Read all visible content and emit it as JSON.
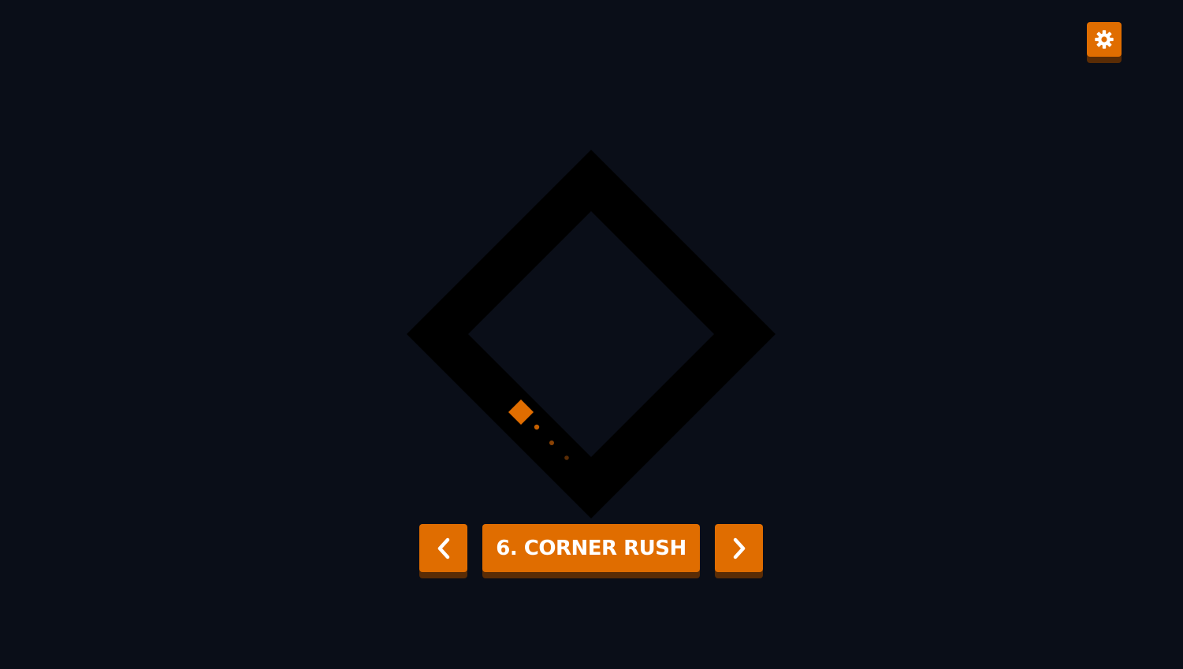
{
  "game": {
    "level_label": "6. CORNER RUSH"
  },
  "icons": {
    "settings": "gear-icon",
    "previous": "chevron-left-icon",
    "next": "chevron-right-icon"
  },
  "colors": {
    "background": "#0a0e18",
    "track": "#000000",
    "accent": "#e06d00",
    "button_shadow": "#5a2c05",
    "button_text": "#ffffff"
  }
}
